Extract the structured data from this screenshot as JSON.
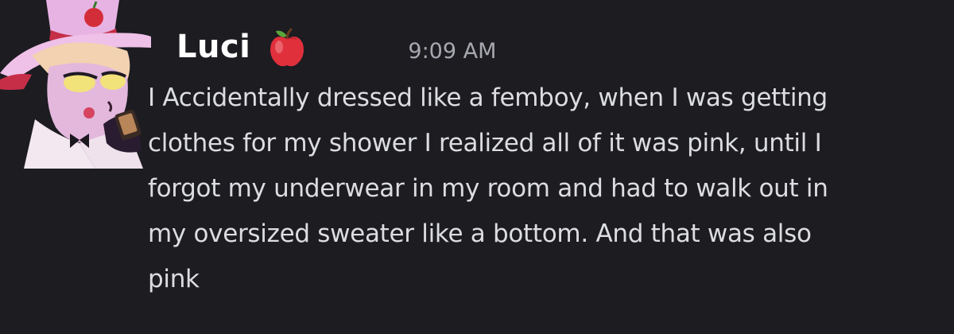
{
  "message": {
    "author": "Luci",
    "author_badge_icon": "apple-icon",
    "timestamp": "9:09 AM",
    "lines": [
      "I Accidentally dressed like a femboy, when I was getting",
      "clothes for my shower I realized all of it was pink, until I",
      "forgot my underwear in my room and had to walk out in",
      "my oversized sweater like a bottom. And that was also",
      "pink"
    ]
  },
  "colors": {
    "background": "#1c1c21",
    "username": "#ffffff",
    "timestamp": "#a8a9b0",
    "message_text": "#dcdde1",
    "apple": "#e0303c"
  }
}
